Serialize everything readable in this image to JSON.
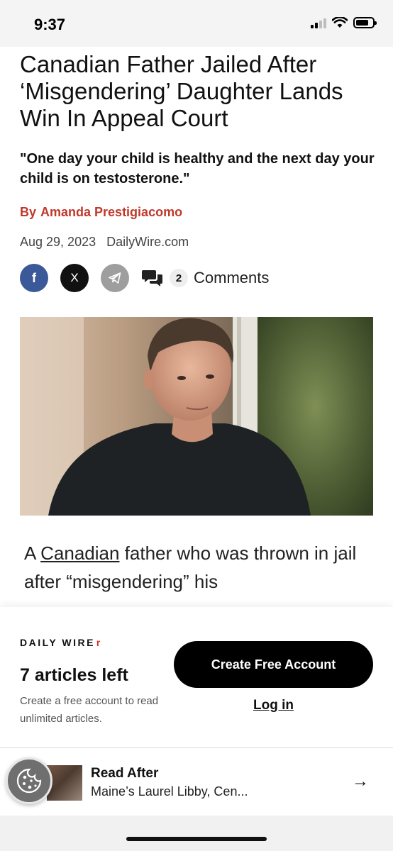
{
  "status_bar": {
    "time": "9:37"
  },
  "article": {
    "headline": "Canadian Father Jailed After ‘Misgendering’ Daughter Lands Win In Appeal Court",
    "subhead": "\"One day your child is healthy and the next day your child is on testosterone.\"",
    "byline_prefix": "By",
    "author": "Amanda Prestigiacomo",
    "date": "Aug 29, 2023",
    "source": "DailyWire.com",
    "body_link": "Canadian",
    "body_before": "A ",
    "body_after": " father who was thrown in jail after “misgendering” his"
  },
  "share": {
    "facebook_label": "f",
    "x_label": "X",
    "comment_count": "2",
    "comments_label": "Comments",
    "icons": [
      "facebook-icon",
      "x-icon",
      "telegram-icon",
      "comments-icon"
    ]
  },
  "paywall": {
    "logo_text": "DAILY WIRE",
    "logo_mark": "r",
    "articles_left": "7 articles left",
    "note": "Create a free account to read unlimited articles.",
    "create_button": "Create Free Account",
    "login_link": "Log in"
  },
  "read_after": {
    "title": "Read After",
    "subtitle": "Maine’s Laurel Libby, Cen...",
    "arrow": "→"
  },
  "colors": {
    "author_red": "#c0392b",
    "facebook_blue": "#3b5998",
    "button_black": "#000000",
    "logo_red": "#d62f2f"
  }
}
